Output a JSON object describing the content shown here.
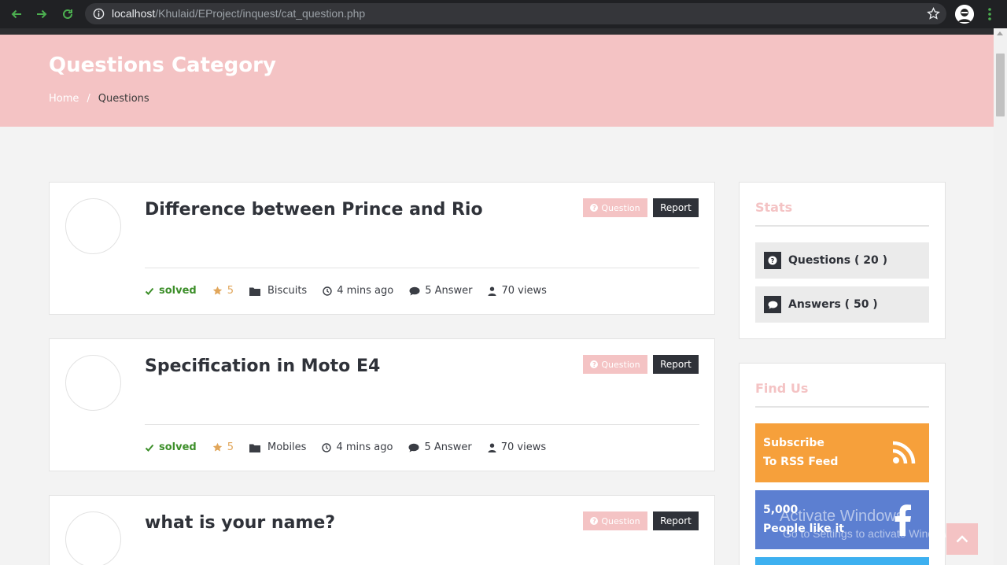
{
  "browser": {
    "url_host": "localhost",
    "url_path": "/Khulaid/EProject/inquest/cat_question.php"
  },
  "header": {
    "title": "Questions Category",
    "breadcrumb": {
      "home": "Home",
      "separator": "/",
      "current": "Questions"
    }
  },
  "questions": [
    {
      "title": "Difference between Prince and Rio",
      "tag": "Question",
      "report": "Report",
      "status": "solved",
      "rating": "5",
      "category": "Biscuits",
      "time": "4 mins ago",
      "answers": "5 Answer",
      "views": "70 views"
    },
    {
      "title": "Specification in Moto E4",
      "tag": "Question",
      "report": "Report",
      "status": "solved",
      "rating": "5",
      "category": "Mobiles",
      "time": "4 mins ago",
      "answers": "5 Answer",
      "views": "70 views"
    },
    {
      "title": "what is your name?",
      "tag": "Question",
      "report": "Report"
    }
  ],
  "sidebar": {
    "stats": {
      "title": "Stats",
      "questions": "Questions ( 20 )",
      "answers": "Answers ( 50 )"
    },
    "find_us": {
      "title": "Find Us",
      "rss_line1": "Subscribe",
      "rss_line2": "To RSS Feed",
      "fb_line1": "5,000",
      "fb_line2": "People like it"
    }
  },
  "watermark": {
    "line1": "Activate Windows",
    "line2": "Go to Settings to activate Windows."
  },
  "colors": {
    "accent_pink": "#f4c3c4",
    "dark": "#2f3239",
    "solved_green": "#3d8f2a",
    "star_orange": "#e1a65a",
    "rss_orange": "#f6a03b",
    "facebook_blue": "#5c7fd1",
    "twitter_blue": "#3db0f0"
  }
}
